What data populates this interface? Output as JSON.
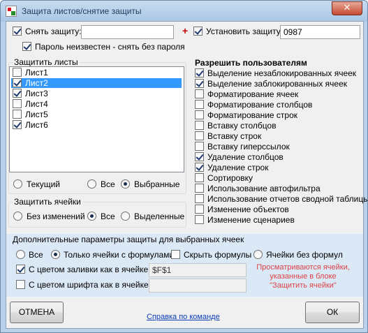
{
  "window": {
    "title": "Защита листов/снятие защиты",
    "close_glyph": "✕"
  },
  "unprotect": {
    "checkbox_label": "Снять защиту:",
    "checked": true,
    "password_value": "",
    "unknown_password_label": "Пароль неизвестен - снять без пароля",
    "unknown_password_checked": true
  },
  "plus_glyph": "+",
  "protect": {
    "checkbox_label": "Установить защиту",
    "checked": true,
    "password_value": "0987"
  },
  "sheets_group": {
    "title": "Защитить листы",
    "items": [
      {
        "label": "Лист1",
        "checked": false,
        "selected": false
      },
      {
        "label": "Лист2",
        "checked": true,
        "selected": true
      },
      {
        "label": "Лист3",
        "checked": true,
        "selected": false
      },
      {
        "label": "Лист4",
        "checked": false,
        "selected": false
      },
      {
        "label": "Лист5",
        "checked": false,
        "selected": false
      },
      {
        "label": "Лист6",
        "checked": true,
        "selected": false
      }
    ],
    "scope_options": [
      {
        "label": "Текущий",
        "checked": false
      },
      {
        "label": "Все",
        "checked": false
      },
      {
        "label": "Выбранные",
        "checked": true
      }
    ]
  },
  "cells_group": {
    "title": "Защитить ячейки",
    "options": [
      {
        "label": "Без изменений",
        "checked": false
      },
      {
        "label": "Все",
        "checked": true
      },
      {
        "label": "Выделенные",
        "checked": false
      }
    ]
  },
  "permissions": {
    "title": "Разрешить пользователям",
    "items": [
      {
        "label": "Выделение незаблокированных ячеек",
        "checked": true
      },
      {
        "label": "Выделение заблокированных ячеек",
        "checked": true
      },
      {
        "label": "Форматирование ячеек",
        "checked": false
      },
      {
        "label": "Форматирование столбцов",
        "checked": false
      },
      {
        "label": "Форматирование строк",
        "checked": false
      },
      {
        "label": "Вставку столбцов",
        "checked": false
      },
      {
        "label": "Вставку строк",
        "checked": false
      },
      {
        "label": "Вставку гиперссылок",
        "checked": false
      },
      {
        "label": "Удаление столбцов",
        "checked": true
      },
      {
        "label": "Удаление строк",
        "checked": true
      },
      {
        "label": "Сортировку",
        "checked": false
      },
      {
        "label": "Использование автофильтра",
        "checked": false
      },
      {
        "label": "Использование отчетов сводной таблицы",
        "checked": false
      },
      {
        "label": "Изменение объектов",
        "checked": false
      },
      {
        "label": "Изменение сценариев",
        "checked": false
      }
    ]
  },
  "extra": {
    "title": "Дополнительные параметры защиты для выбранных ячеек",
    "radio_all": "Все",
    "radio_all_checked": false,
    "radio_formulas": "Только ячейки с формулами",
    "radio_formulas_checked": true,
    "hide_formulas": "Скрыть формулы",
    "hide_formulas_checked": false,
    "radio_no_formulas": "Ячейки без формул",
    "radio_no_formulas_checked": false,
    "fill_color_label": "С цветом заливки как в ячейке:",
    "fill_color_checked": true,
    "fill_color_value": "$F$1",
    "font_color_label": "С цветом шрифта как в ячейке:",
    "font_color_checked": false,
    "font_color_value": "",
    "note": "Просматриваются ячейки, указанные в блоке \"Защитить ячейки\""
  },
  "buttons": {
    "cancel": "ОТМЕНА",
    "ok": "ОК"
  },
  "help_link": "Справка по команде",
  "colors": {
    "selection": "#3399ff",
    "note_red": "#dd4444",
    "link_blue": "#0a3cb5"
  }
}
